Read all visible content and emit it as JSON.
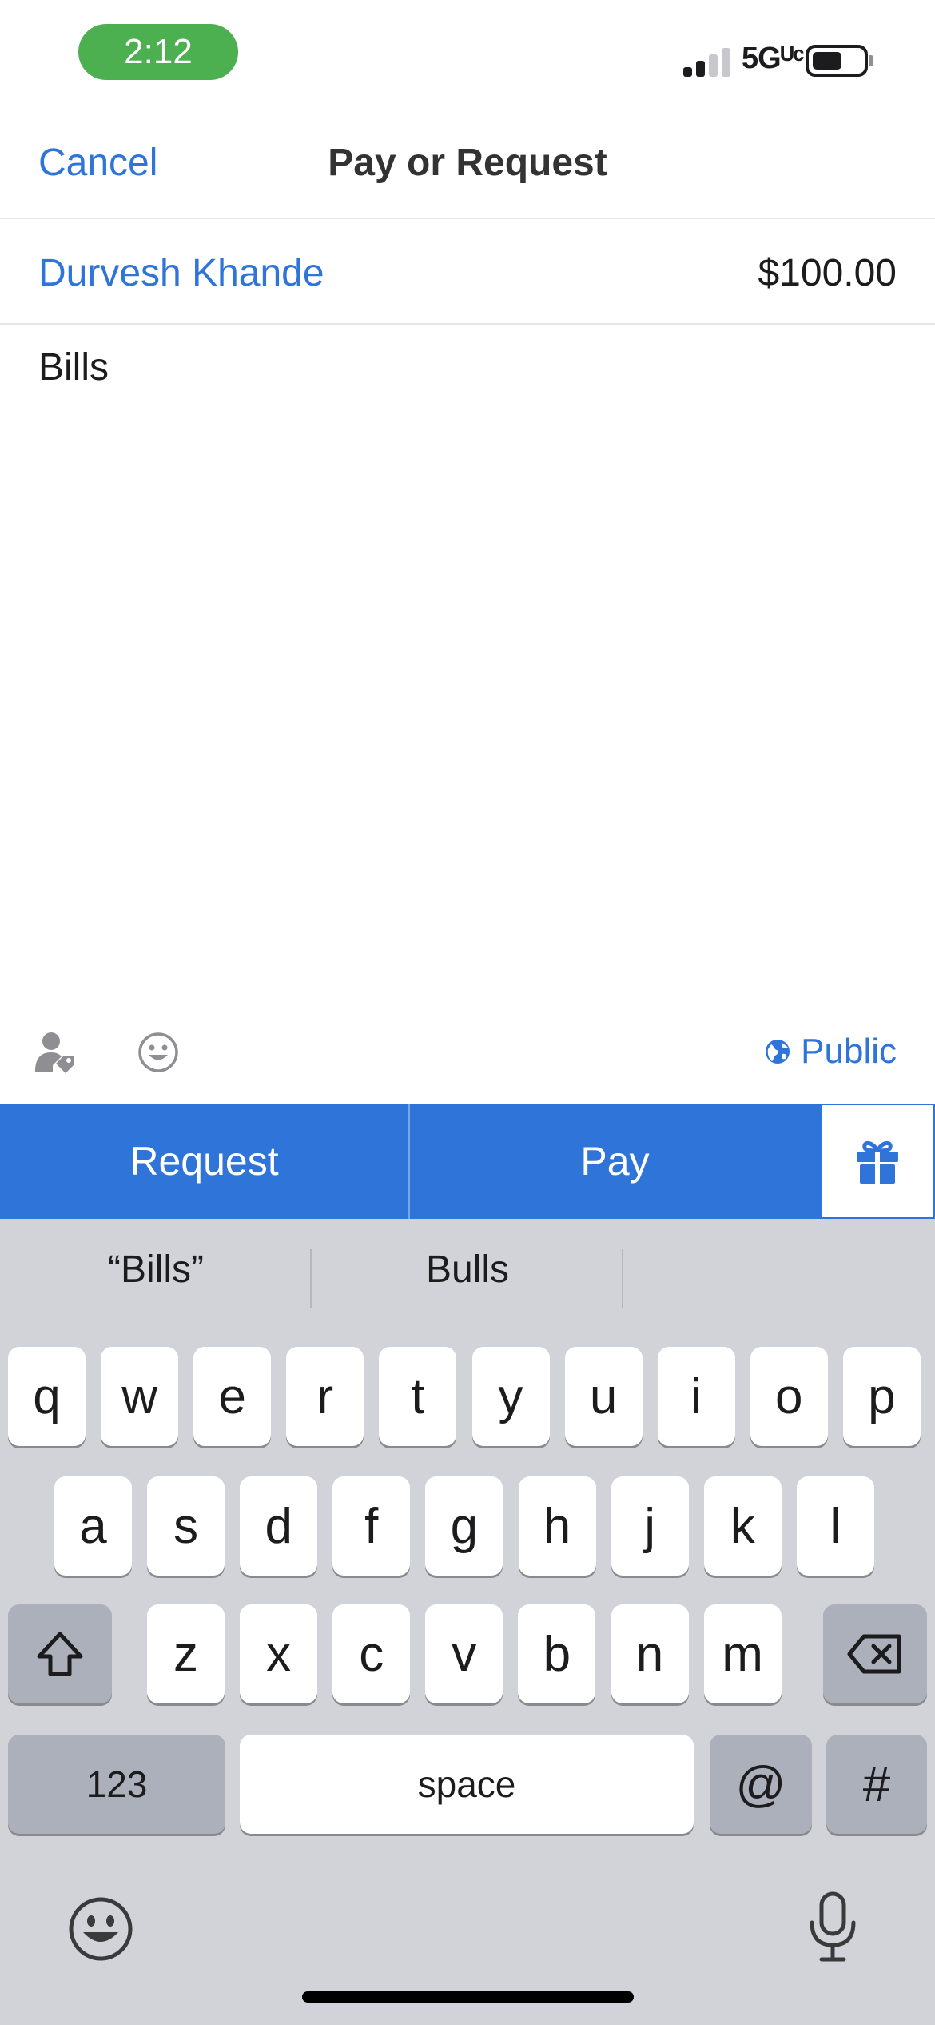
{
  "status_bar": {
    "time": "2:12",
    "network": "5Gᵁᶜ"
  },
  "nav": {
    "cancel_label": "Cancel",
    "title": "Pay or Request"
  },
  "recipient": {
    "name": "Durvesh Khande",
    "amount": "$100.00"
  },
  "note": {
    "text": "Bills"
  },
  "toolbar": {
    "privacy_label": "Public"
  },
  "actions": {
    "request_label": "Request",
    "pay_label": "Pay"
  },
  "keyboard": {
    "suggestions": [
      "“Bills”",
      "Bulls",
      ""
    ],
    "row1": [
      "q",
      "w",
      "e",
      "r",
      "t",
      "y",
      "u",
      "i",
      "o",
      "p"
    ],
    "row2": [
      "a",
      "s",
      "d",
      "f",
      "g",
      "h",
      "j",
      "k",
      "l"
    ],
    "row3": [
      "z",
      "x",
      "c",
      "v",
      "b",
      "n",
      "m"
    ],
    "numbers_label": "123",
    "space_label": "space",
    "at_label": "@",
    "hash_label": "#"
  },
  "colors": {
    "accent": "#2f74d8",
    "time_pill": "#4caf50",
    "keyboard_bg": "#d1d3d9"
  },
  "icons": [
    "signal-icon",
    "battery-icon",
    "tag-person-icon",
    "emoji-icon",
    "globe-icon",
    "gift-icon",
    "shift-icon",
    "backspace-icon",
    "emoji-keyboard-icon",
    "microphone-icon"
  ]
}
